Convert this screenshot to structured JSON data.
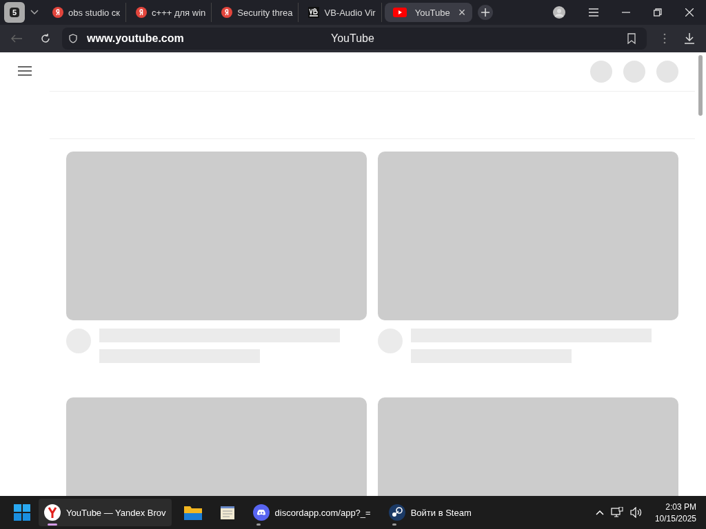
{
  "browser": {
    "tab_counter": "5",
    "tabs": [
      {
        "kind": "yandex",
        "label": "obs studio ск",
        "selected": false
      },
      {
        "kind": "yandex",
        "label": "c+++ для win",
        "selected": false
      },
      {
        "kind": "yandex",
        "label": "Security threa",
        "selected": false
      },
      {
        "kind": "vb",
        "label": "VB-Audio Vir",
        "selected": false
      },
      {
        "kind": "youtube",
        "label": "YouTube",
        "selected": true
      }
    ],
    "close_glyph": "×",
    "address": {
      "url": "www.youtube.com",
      "title": "YouTube"
    }
  },
  "taskbar": {
    "items": [
      {
        "kind": "yandex",
        "label": "YouTube — Yandex Brov",
        "active": true
      },
      {
        "kind": "folder",
        "active": false
      },
      {
        "kind": "notepad",
        "active": false
      },
      {
        "kind": "discord",
        "label": "discordapp.com/app?_=",
        "active": true
      },
      {
        "kind": "steam",
        "label": "Войти в Steam",
        "active": true
      }
    ],
    "time": "2:03 PM",
    "date": "10/15/2025"
  }
}
